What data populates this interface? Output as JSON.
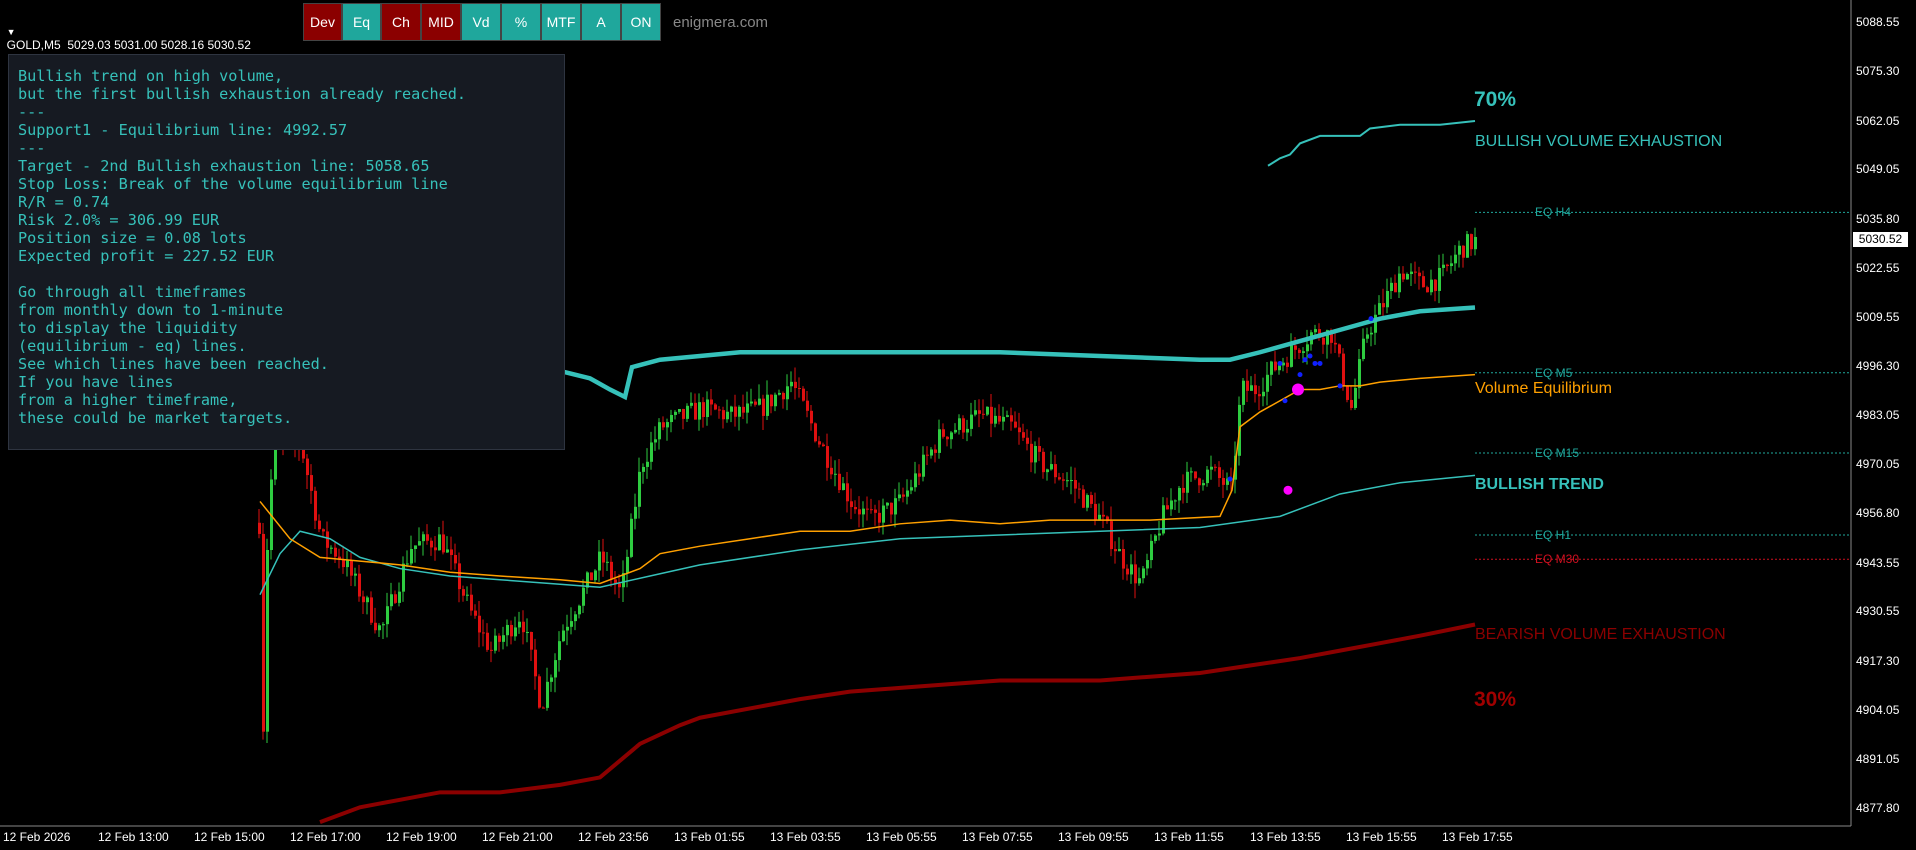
{
  "symbol_bar": {
    "text": "GOLD,M5  5029.03 5031.00 5028.16 5030.52"
  },
  "toolbar": {
    "buttons": [
      {
        "label": "Dev",
        "color": "#8b0000"
      },
      {
        "label": "Eq",
        "color": "#1fa79c"
      },
      {
        "label": "Ch",
        "color": "#8b0000"
      },
      {
        "label": "MID",
        "color": "#8b0000"
      },
      {
        "label": "Vd",
        "color": "#1fa79c"
      },
      {
        "label": "%",
        "color": "#1fa79c"
      },
      {
        "label": "MTF",
        "color": "#1fa79c"
      },
      {
        "label": "A",
        "color": "#1fa79c"
      },
      {
        "label": "ON",
        "color": "#1fa79c"
      }
    ]
  },
  "site_label": "enigmera.com",
  "info_panel": {
    "text": "Bullish trend on high volume,\nbut the first bullish exhaustion already reached.\n---\nSupport1 - Equilibrium line: 4992.57\n---\nTarget - 2nd Bullish exhaustion line: 5058.65\nStop Loss: Break of the volume equilibrium line\nR/R = 0.74\nRisk 2.0% = 306.99 EUR\nPosition size = 0.08 lots\nExpected profit = 227.52 EUR\n\nGo through all timeframes\nfrom monthly down to 1-minute\nto display the liquidity\n(equilibrium - eq) lines.\nSee which lines have been reached.\nIf you have lines\nfrom a higher timeframe,\nthese could be market targets."
  },
  "price_axis": {
    "labels": [
      "5088.55",
      "5075.30",
      "5062.05",
      "5049.05",
      "5035.80",
      "5022.55",
      "5009.55",
      "4996.30",
      "4983.05",
      "4970.05",
      "4956.80",
      "4943.55",
      "4930.55",
      "4917.30",
      "4904.05",
      "4891.05",
      "4877.80"
    ],
    "current_price": "5030.52"
  },
  "time_axis": {
    "labels": [
      "12 Feb 2026",
      "12 Feb 13:00",
      "12 Feb 15:00",
      "12 Feb 17:00",
      "12 Feb 19:00",
      "12 Feb 21:00",
      "12 Feb 23:56",
      "13 Feb 01:55",
      "13 Feb 03:55",
      "13 Feb 05:55",
      "13 Feb 07:55",
      "13 Feb 09:55",
      "13 Feb 11:55",
      "13 Feb 13:55",
      "13 Feb 15:55",
      "13 Feb 17:55"
    ]
  },
  "chart_labels": {
    "pct_top": "70%",
    "pct_bottom": "30%",
    "bullish_exhaustion": "BULLISH VOLUME EXHAUSTION",
    "volume_equilibrium": "Volume Equilibrium",
    "bullish_trend": "BULLISH TREND",
    "bearish_exhaustion": "BEARISH VOLUME EXHAUSTION"
  },
  "eq_lines": [
    {
      "label": "EQ H4",
      "price": 5037.5,
      "color": "#1fa79c"
    },
    {
      "label": "EQ M5",
      "price": 4994.5,
      "color": "#1fa79c"
    },
    {
      "label": "EQ M15",
      "price": 4973.0,
      "color": "#1fa79c"
    },
    {
      "label": "EQ H1",
      "price": 4951.0,
      "color": "#1fa79c"
    },
    {
      "label": "EQ M30",
      "price": 4944.5,
      "color": "#d01020"
    }
  ],
  "colors": {
    "bull": "#2ecc40",
    "bear": "#e01010",
    "teal": "#36c1ba",
    "orange": "#ffa000",
    "darkred": "#8b0000"
  }
}
